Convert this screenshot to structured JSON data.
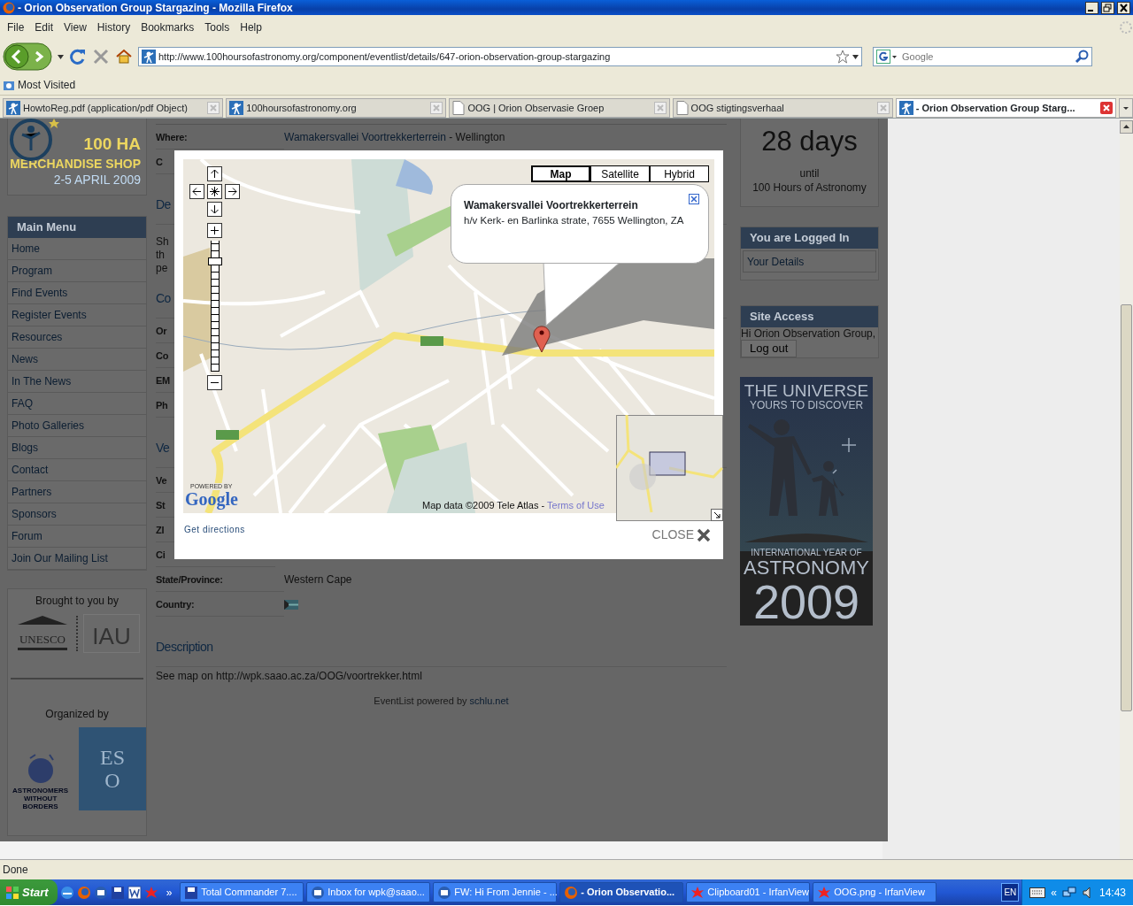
{
  "window": {
    "title": "- Orion Observation Group Stargazing - Mozilla Firefox"
  },
  "menu": [
    "File",
    "Edit",
    "View",
    "History",
    "Bookmarks",
    "Tools",
    "Help"
  ],
  "toolbar": {
    "url": "http://www.100hoursofastronomy.org/component/eventlist/details/647-orion-observation-group-stargazing",
    "search_placeholder": "Google"
  },
  "bookmarks": [
    "Most Visited"
  ],
  "tabs": [
    {
      "label": "HowtoReg.pdf (application/pdf Object)",
      "selected": false,
      "kind": "site"
    },
    {
      "label": "100hoursofastronomy.org",
      "selected": false,
      "kind": "site"
    },
    {
      "label": "OOG | Orion Observasie Groep",
      "selected": false,
      "kind": "doc"
    },
    {
      "label": "OOG stigtingsverhaal",
      "selected": false,
      "kind": "doc"
    },
    {
      "label": "- Orion Observation Group Starg...",
      "selected": true,
      "kind": "site"
    }
  ],
  "sidebar": {
    "banner": [
      "100 HA",
      "MERCHANDISE SHOP",
      "2-5 APRIL 2009"
    ],
    "menu_title": "Main Menu",
    "menu_items": [
      "Home",
      "Program",
      "Find Events",
      "Register Events",
      "Resources",
      "News",
      "In The News",
      "FAQ",
      "Photo Galleries",
      "Blogs",
      "Contact",
      "Partners",
      "Sponsors",
      "Forum",
      "Join Our Mailing List"
    ],
    "brought_by": "Brought to you by",
    "brought_logos": [
      "UNESCO",
      "IAU"
    ],
    "organized_by": "Organized by",
    "organized_logos": [
      {
        "kind": "awb",
        "text": "ASTRONOMERS WITHOUT BORDERS"
      },
      {
        "kind": "eso",
        "text": "ESO"
      }
    ]
  },
  "details": {
    "where_label": "Where:",
    "where_link": "Wamakersvallei Voortrekkerterrein",
    "where_suffix": " - Wellington",
    "rows": [
      {
        "kind": "label",
        "text": "C"
      },
      {
        "kind": "heading",
        "text": "De"
      },
      {
        "kind": "para",
        "text": "Sh"
      },
      {
        "kind": "para",
        "text": "th"
      },
      {
        "kind": "para",
        "text": "pe"
      },
      {
        "kind": "heading",
        "text": "Co"
      },
      {
        "kind": "label",
        "text": "Or"
      },
      {
        "kind": "label",
        "text": "Co"
      },
      {
        "kind": "label",
        "text": "EM"
      },
      {
        "kind": "label",
        "text": "Ph"
      },
      {
        "kind": "heading",
        "text": "Ve"
      },
      {
        "kind": "label",
        "text": "Ve"
      },
      {
        "kind": "label",
        "text": "St"
      },
      {
        "kind": "label",
        "text": "ZI"
      },
      {
        "kind": "label",
        "text": "Ci"
      },
      {
        "kind": "field",
        "text": "State/Province:",
        "value": "Western Cape"
      },
      {
        "kind": "flag",
        "text": "Country:"
      },
      {
        "kind": "heading",
        "text": "Description"
      },
      {
        "kind": "para",
        "text": "See map on http://wpk.saao.ac.za/OOG/voortrekker.html"
      }
    ],
    "footer": "EventList powered by ",
    "footer_link": "schlu.net"
  },
  "right": {
    "countdown": [
      "28 days",
      "until",
      "100 Hours of Astronomy"
    ],
    "logged_in_title": "You are Logged In",
    "logged_in_link": "Your Details",
    "access_title": "Site Access",
    "greeting": "Hi Orion Observation Group,",
    "logout": "Log out",
    "iya": [
      "THE UNIVERSE",
      "YOURS TO DISCOVER",
      "INTERNATIONAL YEAR OF",
      "ASTRONOMY",
      "2009"
    ]
  },
  "map_dialog": {
    "map_types": [
      {
        "label": "Map",
        "selected": true
      },
      {
        "label": "Satellite",
        "selected": false
      },
      {
        "label": "Hybrid",
        "selected": false
      }
    ],
    "zoom": {
      "level": 0.86
    },
    "info_title": "Wamakersvallei Voortrekkerterrein",
    "info_address": "h/v Kerk- en Barlinka strate, 7655 Wellington, ZA",
    "powered_by": "POWERED BY",
    "logo": "Google",
    "attribution": "Map data ©2009 Tele Atlas - ",
    "terms": "Terms of Use",
    "directions": "Get directions",
    "close": "CLOSE"
  },
  "status_bar": "Done",
  "taskbar": {
    "start": "Start",
    "more": "»",
    "tasks": [
      {
        "label": "Total Commander 7....",
        "selected": false,
        "kind": "disk"
      },
      {
        "label": "Inbox for wpk@saao...",
        "selected": false,
        "kind": "mail"
      },
      {
        "label": "FW: Hi From Jennie - ...",
        "selected": false,
        "kind": "mail"
      },
      {
        "label": "- Orion Observatio...",
        "selected": true,
        "kind": "fox"
      },
      {
        "label": "Clipboard01 - IrfanView",
        "selected": false,
        "kind": "irfan"
      },
      {
        "label": "OOG.png - IrfanView",
        "selected": false,
        "kind": "irfan"
      }
    ],
    "lang": "EN",
    "expand": "«",
    "time": "14:43"
  }
}
